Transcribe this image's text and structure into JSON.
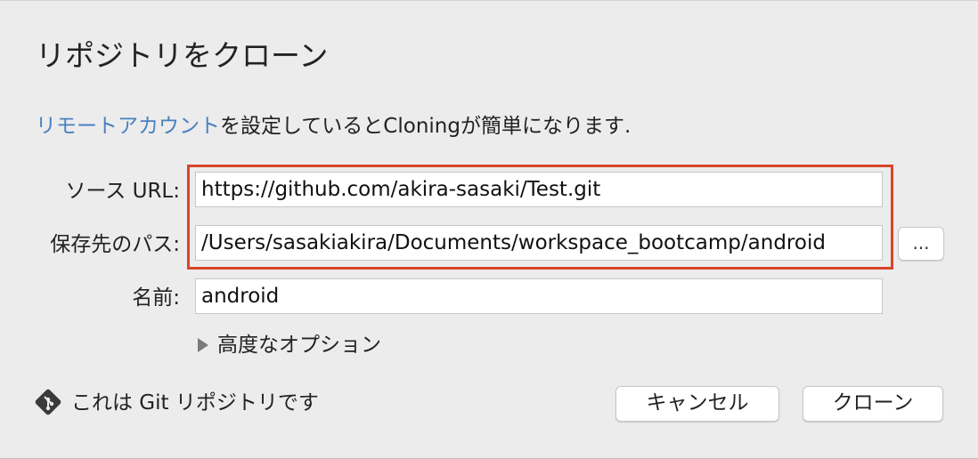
{
  "dialog": {
    "title": "リポジトリをクローン",
    "info": {
      "link_text": "リモートアカウント",
      "rest_text": "を設定しているとCloningが簡単になります."
    },
    "source": {
      "label": "ソース URL:",
      "value": "https://github.com/akira-sasaki/Test.git"
    },
    "destination": {
      "label": "保存先のパス:",
      "value": "/Users/sasakiakira/Documents/workspace_bootcamp/android",
      "browse_label": "..."
    },
    "name": {
      "label": "名前:",
      "value": "android"
    },
    "advanced_label": "高度なオプション",
    "git_status": "これは Git リポジトリです",
    "cancel_label": "キャンセル",
    "clone_label": "クローン"
  },
  "colors": {
    "link": "#4a80c0",
    "highlight": "#d9452b",
    "background": "#ececec"
  },
  "icons": {
    "git": "git-icon",
    "disclosure": "disclosure-triangle-icon"
  }
}
